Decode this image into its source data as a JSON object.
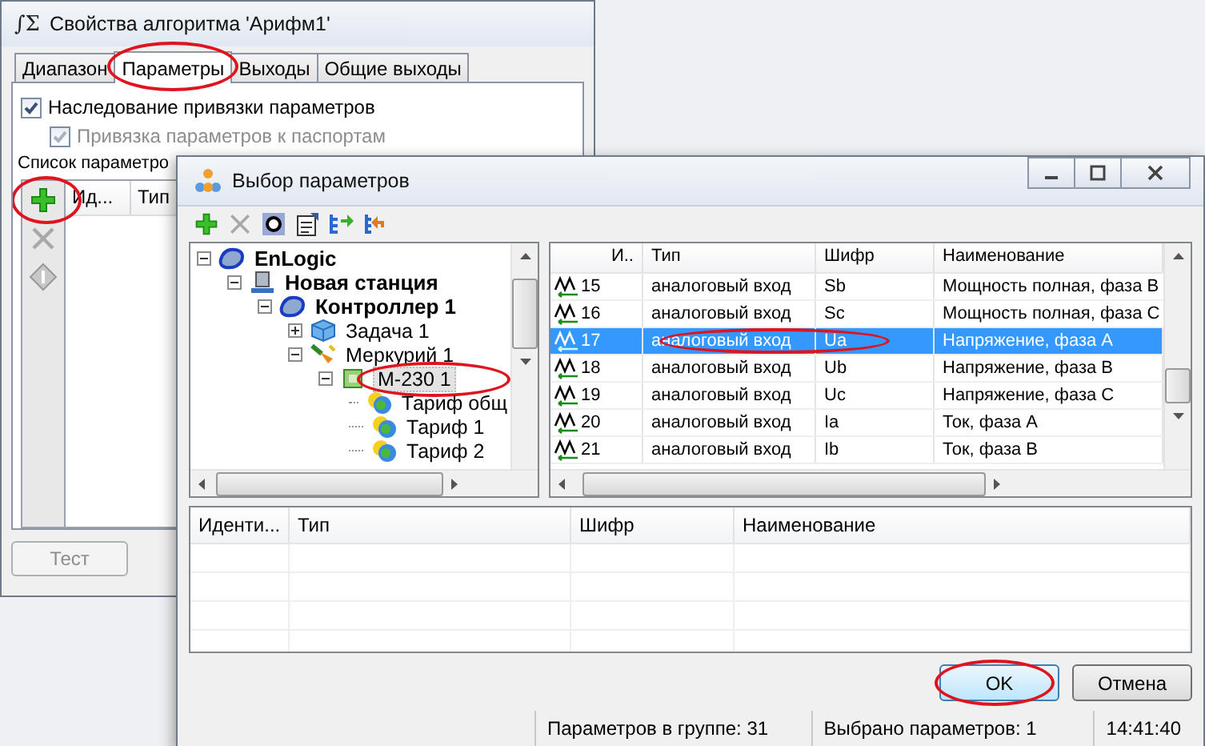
{
  "back_window": {
    "icon_text": "∫Σ",
    "title": "Свойства алгоритма 'Арифм1'",
    "tabs": [
      {
        "label": "Диапазон",
        "selected": false,
        "annotated": false
      },
      {
        "label": "Параметры",
        "selected": true,
        "annotated": true
      },
      {
        "label": "Выходы",
        "selected": false,
        "annotated": false
      },
      {
        "label": "Общие выходы",
        "selected": false,
        "annotated": false
      }
    ],
    "checkboxes": [
      {
        "label": "Наследование привязки параметров",
        "checked": true,
        "disabled": false
      },
      {
        "label": "Привязка параметров к паспортам",
        "checked": true,
        "disabled": true
      }
    ],
    "list_label": "Список параметро",
    "tools": [
      {
        "kind": "add",
        "disabled": false,
        "annotated": true
      },
      {
        "kind": "delete",
        "disabled": true,
        "annotated": false
      },
      {
        "kind": "diamond",
        "disabled": true,
        "annotated": false
      }
    ],
    "columns": [
      "Ид...",
      "Тип"
    ],
    "test_button": {
      "label": "Тест",
      "disabled": true
    }
  },
  "front_window": {
    "title": "Выбор параметров",
    "toolbar": [
      {
        "kind": "add"
      },
      {
        "kind": "delete"
      },
      {
        "kind": "letter"
      },
      {
        "kind": "clipboard"
      },
      {
        "kind": "tree-in"
      },
      {
        "kind": "tree-out"
      }
    ],
    "tree": [
      {
        "label": "EnLogic",
        "kind": "root",
        "bold": true,
        "expanded": true,
        "selected": false,
        "annotated": false,
        "children": [
          {
            "label": "Новая станция",
            "kind": "station",
            "bold": true,
            "expanded": true,
            "selected": false,
            "annotated": false,
            "children": [
              {
                "label": "Контроллер 1",
                "kind": "controller",
                "bold": true,
                "expanded": true,
                "selected": false,
                "annotated": false,
                "children": [
                  {
                    "label": "Задача 1",
                    "kind": "task",
                    "bold": false,
                    "expanded": false,
                    "selected": false,
                    "annotated": false
                  },
                  {
                    "label": "Меркурий 1",
                    "kind": "meter",
                    "bold": false,
                    "expanded": true,
                    "selected": false,
                    "annotated": false,
                    "children": [
                      {
                        "label": "M-230 1",
                        "kind": "device",
                        "bold": false,
                        "expanded": true,
                        "selected": true,
                        "annotated": true,
                        "children": [
                          {
                            "label": "Тариф общ",
                            "kind": "tariff",
                            "bold": false,
                            "selected": false,
                            "annotated": false
                          },
                          {
                            "label": "Тариф 1",
                            "kind": "tariff",
                            "bold": false,
                            "selected": false,
                            "annotated": false
                          },
                          {
                            "label": "Тариф 2",
                            "kind": "tariff",
                            "bold": false,
                            "selected": false,
                            "annotated": false
                          }
                        ]
                      }
                    ]
                  }
                ]
              }
            ]
          }
        ]
      }
    ],
    "grid": {
      "columns": [
        "И..",
        "Тип",
        "Шифр",
        "Наименование"
      ],
      "rows": [
        {
          "id": "15",
          "type": "аналоговый вход",
          "code": "Sb",
          "name": "Мощность полная, фаза B",
          "selected": false,
          "annotated": false
        },
        {
          "id": "16",
          "type": "аналоговый вход",
          "code": "Sc",
          "name": "Мощность полная, фаза C",
          "selected": false,
          "annotated": false
        },
        {
          "id": "17",
          "type": "аналоговый вход",
          "code": "Ua",
          "name": "Напряжение, фаза A",
          "selected": true,
          "annotated": true
        },
        {
          "id": "18",
          "type": "аналоговый вход",
          "code": "Ub",
          "name": "Напряжение, фаза B",
          "selected": false,
          "annotated": false
        },
        {
          "id": "19",
          "type": "аналоговый вход",
          "code": "Uc",
          "name": "Напряжение, фаза C",
          "selected": false,
          "annotated": false
        },
        {
          "id": "20",
          "type": "аналоговый вход",
          "code": "Ia",
          "name": "Ток, фаза A",
          "selected": false,
          "annotated": false
        },
        {
          "id": "21",
          "type": "аналоговый вход",
          "code": "Ib",
          "name": "Ток, фаза B",
          "selected": false,
          "annotated": false
        }
      ]
    },
    "selected_table": {
      "columns": [
        "Иденти...",
        "Тип",
        "Шифр",
        "Наименование"
      ]
    },
    "buttons": [
      {
        "label": "OK",
        "default": true,
        "annotated": true
      },
      {
        "label": "Отмена",
        "default": false,
        "annotated": false
      }
    ],
    "status_bar": [
      "Параметров в группе: 31",
      "Выбрано параметров: 1",
      "14:41:40"
    ]
  }
}
